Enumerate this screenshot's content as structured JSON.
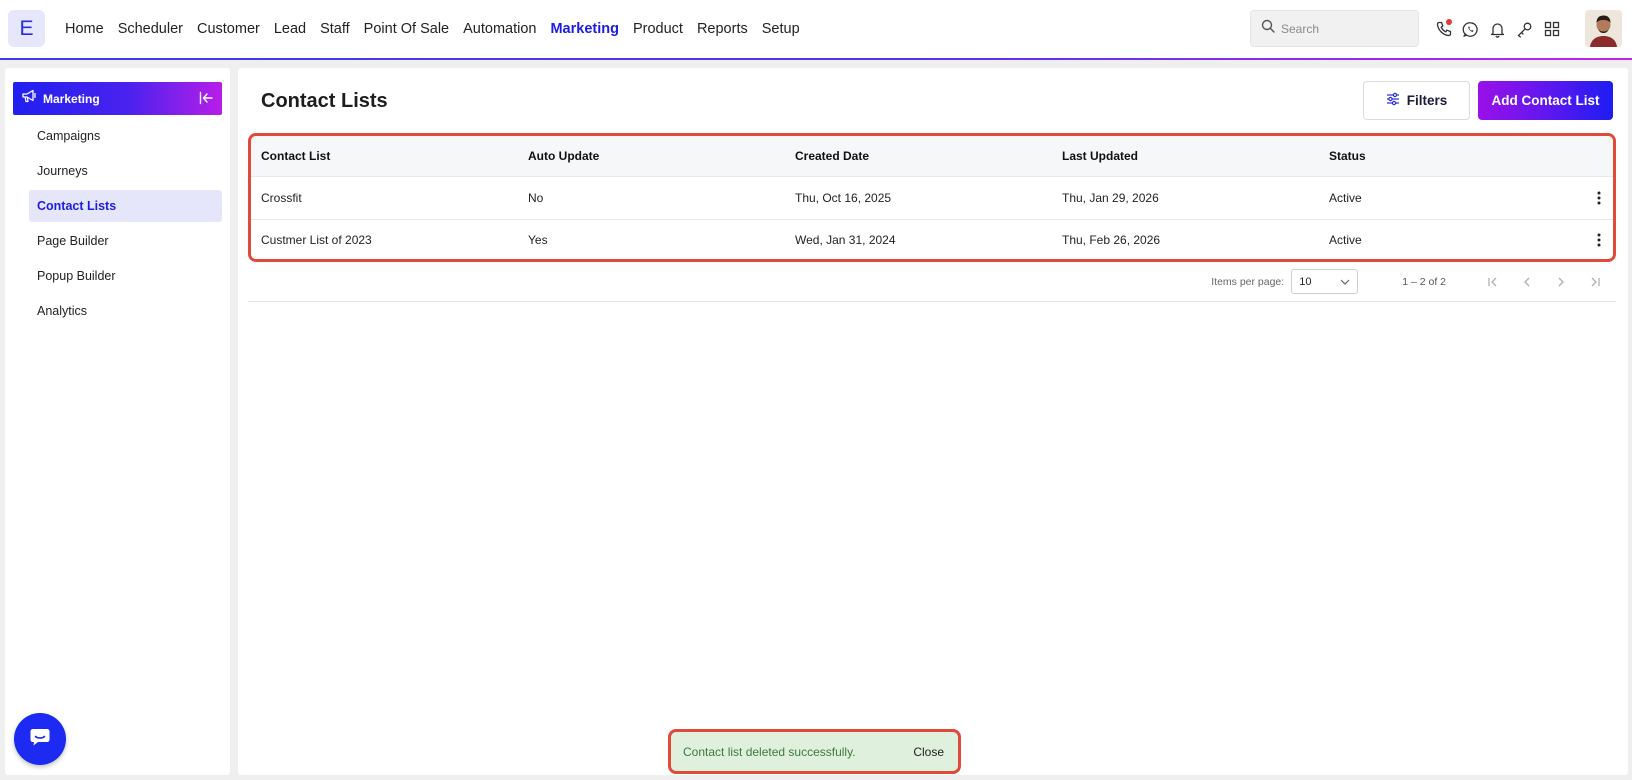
{
  "app": {
    "logo_letter": "E"
  },
  "nav": {
    "items": [
      {
        "label": "Home",
        "active": false
      },
      {
        "label": "Scheduler",
        "active": false
      },
      {
        "label": "Customer",
        "active": false
      },
      {
        "label": "Lead",
        "active": false
      },
      {
        "label": "Staff",
        "active": false
      },
      {
        "label": "Point Of Sale",
        "active": false
      },
      {
        "label": "Automation",
        "active": false
      },
      {
        "label": "Marketing",
        "active": true
      },
      {
        "label": "Product",
        "active": false
      },
      {
        "label": "Reports",
        "active": false
      },
      {
        "label": "Setup",
        "active": false
      }
    ]
  },
  "search": {
    "placeholder": "Search",
    "value": ""
  },
  "top_icons": [
    "phone-icon",
    "whatsapp-icon",
    "bell-icon",
    "key-icon",
    "apps-grid-icon"
  ],
  "sidebar": {
    "header_title": "Marketing",
    "items": [
      {
        "label": "Campaigns",
        "active": false
      },
      {
        "label": "Journeys",
        "active": false
      },
      {
        "label": "Contact Lists",
        "active": true
      },
      {
        "label": "Page Builder",
        "active": false
      },
      {
        "label": "Popup Builder",
        "active": false
      },
      {
        "label": "Analytics",
        "active": false
      }
    ]
  },
  "main": {
    "title": "Contact Lists",
    "filters_label": "Filters",
    "add_label": "Add Contact List",
    "table": {
      "columns": [
        "Contact List",
        "Auto Update",
        "Created Date",
        "Last Updated",
        "Status"
      ],
      "rows": [
        [
          "Crossfit",
          "No",
          "Thu, Oct 16, 2025",
          "Thu, Jan 29, 2026",
          "Active"
        ],
        [
          "Custmer List of 2023",
          "Yes",
          "Wed, Jan 31, 2024",
          "Thu, Feb 26, 2026",
          "Active"
        ]
      ]
    },
    "paginator": {
      "items_per_page_label": "Items per page:",
      "items_per_page_value": "10",
      "range_label": "1 – 2 of 2"
    }
  },
  "toast": {
    "message": "Contact list deleted successfully.",
    "close_label": "Close"
  },
  "colors": {
    "accent": "#1c1ce4",
    "gradient_start": "#9b10e8",
    "gradient_end": "#1d1df2",
    "highlight_border": "#e04a38",
    "toast_bg": "#dff0dc"
  }
}
